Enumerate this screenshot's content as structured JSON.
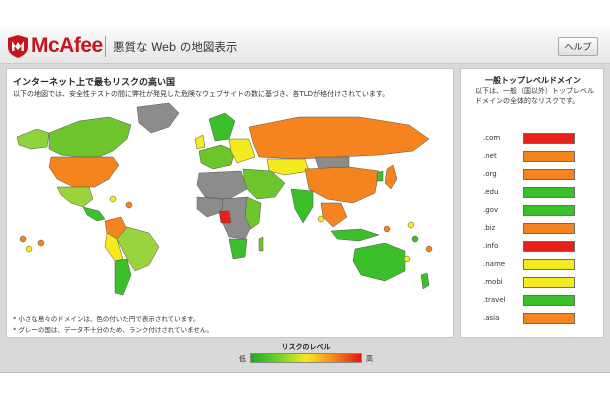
{
  "app": {
    "brand": "McAfee",
    "title": "悪質な Web の地図表示",
    "help_label": "ヘルプ"
  },
  "map": {
    "title": "インターネット上で最もリスクの高い国",
    "subtitle": "以下の地図では、安全性テストの間に弊社が発見した危険なウェブサイトの数に基づき、各TLDが格付けされています。",
    "notes": [
      "* 小さな島々のドメインは、色の付いた円で表示されています。",
      "* グレーの国は、データ不十分のため、ランク付けされていません。"
    ]
  },
  "tld": {
    "title": "一般トップレベルドメイン",
    "subtitle": "以下は、一般（国以外）トップレベルドメインの全体的なリスクです。",
    "items": [
      {
        "label": ".com",
        "color": "#e8201b"
      },
      {
        "label": ".net",
        "color": "#f5841f"
      },
      {
        "label": ".org",
        "color": "#f5841f"
      },
      {
        "label": ".edu",
        "color": "#3bbf2a"
      },
      {
        "label": ".gov",
        "color": "#3bbf2a"
      },
      {
        "label": ".biz",
        "color": "#f5841f"
      },
      {
        "label": ".info",
        "color": "#e8201b"
      },
      {
        "label": ".name",
        "color": "#f5ea1d"
      },
      {
        "label": ".mobi",
        "color": "#f5ea1d"
      },
      {
        "label": ".travel",
        "color": "#3bbf2a"
      },
      {
        "label": ".asia",
        "color": "#f5841f"
      }
    ]
  },
  "legend": {
    "title": "リスクのレベル",
    "low": "低",
    "high": "高",
    "colors": [
      "#22aa22",
      "#6fd428",
      "#f5ea1d",
      "#f58a1a",
      "#e61414"
    ]
  }
}
